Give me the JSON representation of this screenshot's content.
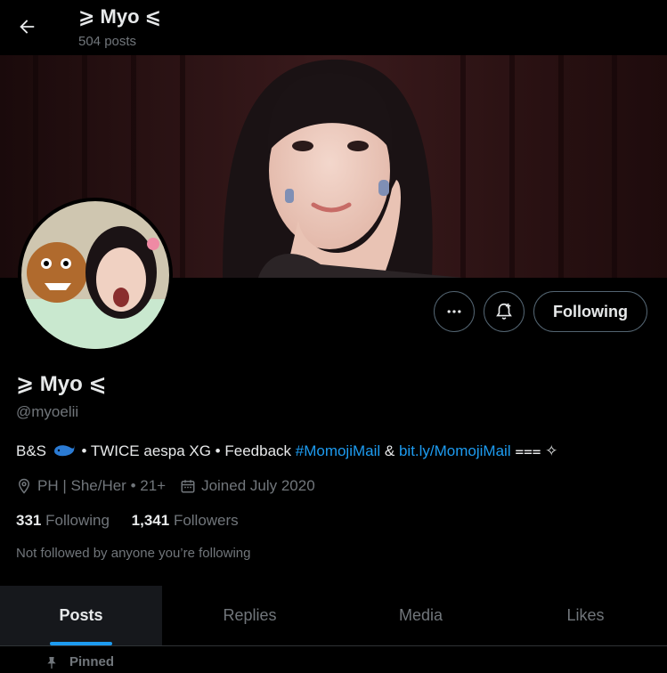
{
  "header": {
    "back_icon": "arrow-left-icon",
    "name": "⩾ Myo ⩽",
    "post_count": "504 posts"
  },
  "profile": {
    "display_name": "⩾ Myo ⩽",
    "handle": "@myoelii",
    "bio": {
      "text_start": "B&S",
      "whale_icon": "whale-emoji",
      "text_mid": " • TWICE aespa XG • Feedback ",
      "hashtag": "#MomojiMail",
      "amp": " & ",
      "link": "bit.ly/MomojiMail",
      "text_end": " ⩶ ✧"
    },
    "location": "PH | She/Her • 21+",
    "joined": "Joined July 2020",
    "following_count": "331",
    "following_label": "Following",
    "followers_count": "1,341",
    "followers_label": "Followers",
    "not_followed": "Not followed by anyone you’re following"
  },
  "actions": {
    "more_icon": "more-dots-icon",
    "notify_icon": "bell-plus-icon",
    "following_label": "Following"
  },
  "tabs": [
    {
      "label": "Posts",
      "active": true
    },
    {
      "label": "Replies",
      "active": false
    },
    {
      "label": "Media",
      "active": false
    },
    {
      "label": "Likes",
      "active": false
    }
  ],
  "pinned_label": "Pinned",
  "colors": {
    "accent": "#1d9bf0",
    "text_primary": "#e7e9ea",
    "text_secondary": "#71767b",
    "border": "#536471",
    "background": "#000000"
  }
}
